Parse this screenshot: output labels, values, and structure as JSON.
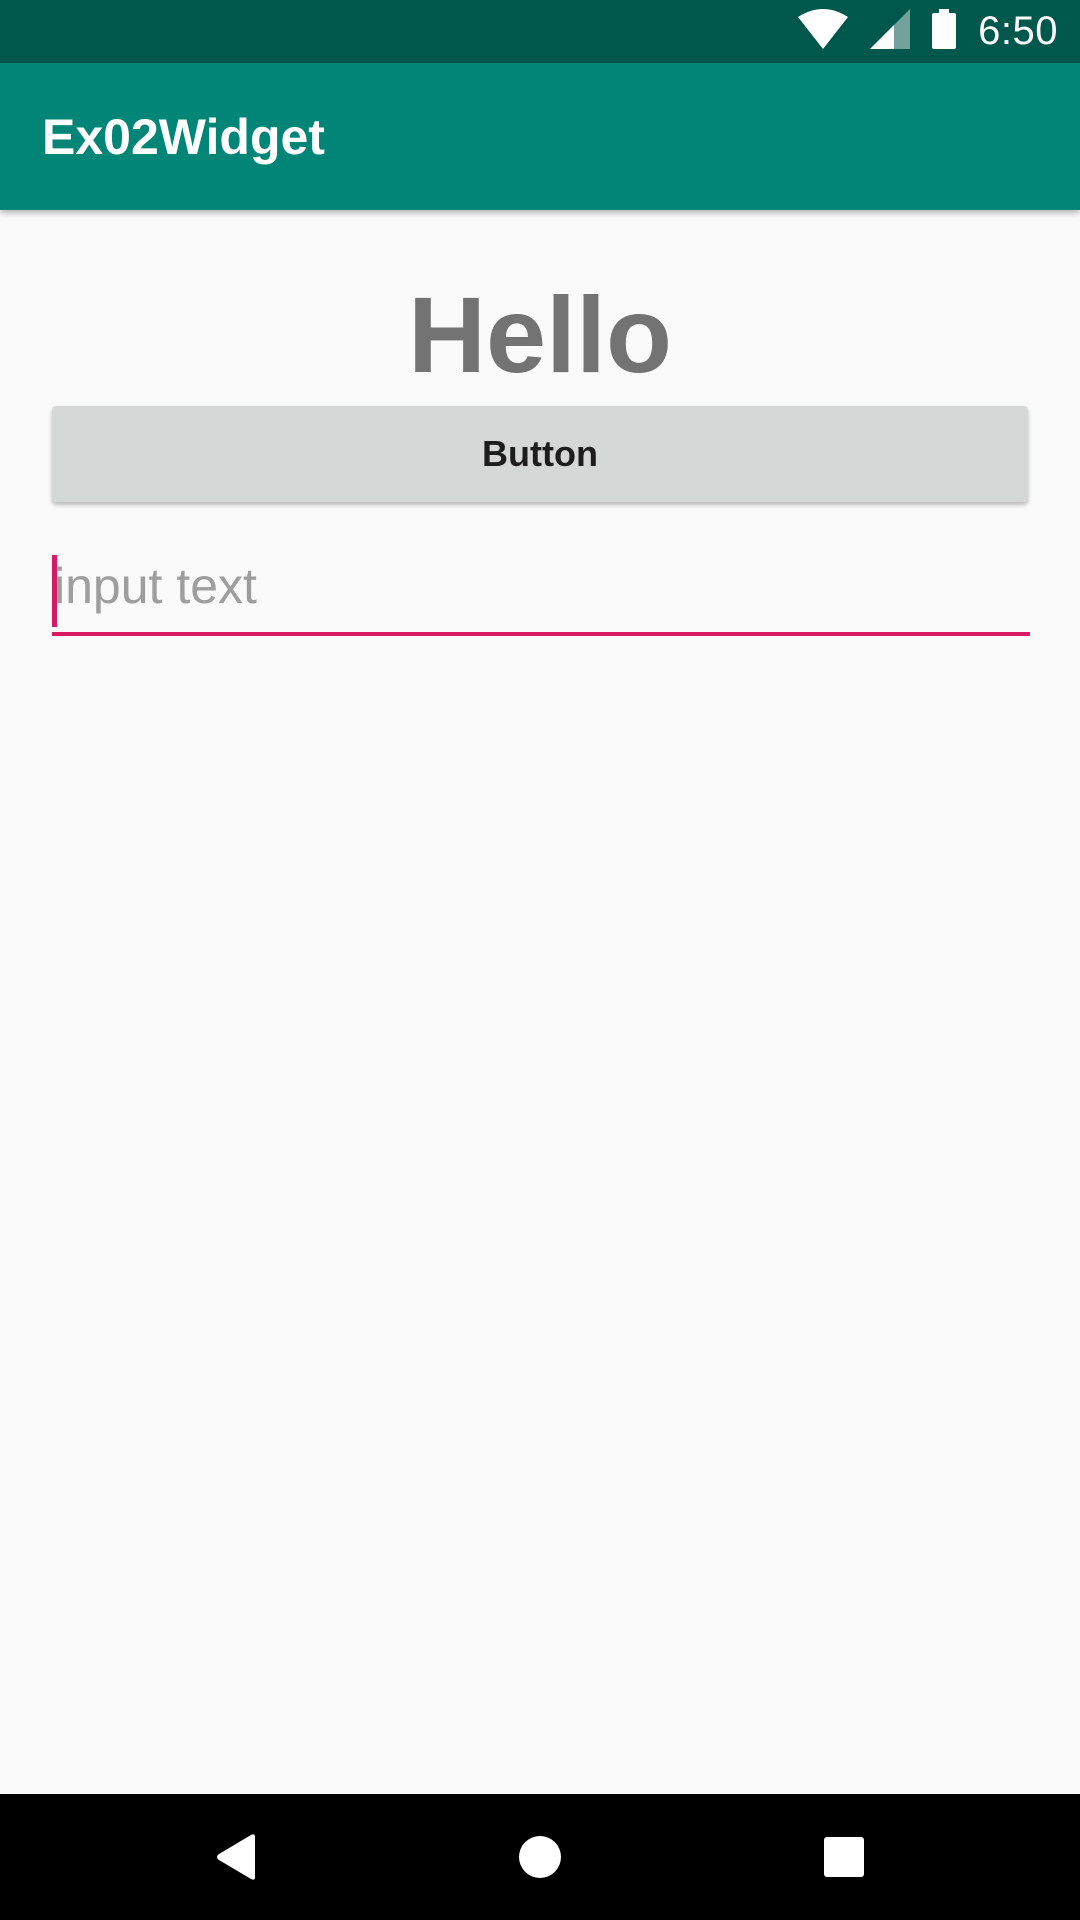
{
  "status_bar": {
    "time": "6:50",
    "icons": [
      "wifi-icon",
      "cell-signal-icon",
      "battery-icon"
    ]
  },
  "app_bar": {
    "title": "Ex02Widget"
  },
  "main": {
    "hello_text": "Hello",
    "button_label": "Button",
    "input": {
      "value": "",
      "placeholder": "input text"
    }
  },
  "nav_bar": {
    "icons": [
      "back-icon",
      "home-icon",
      "recents-icon"
    ]
  },
  "colors": {
    "status_bar": "#00574b",
    "app_bar": "#008577",
    "accent": "#d81b60",
    "background": "#fafafa",
    "button": "#d6d7d7"
  }
}
